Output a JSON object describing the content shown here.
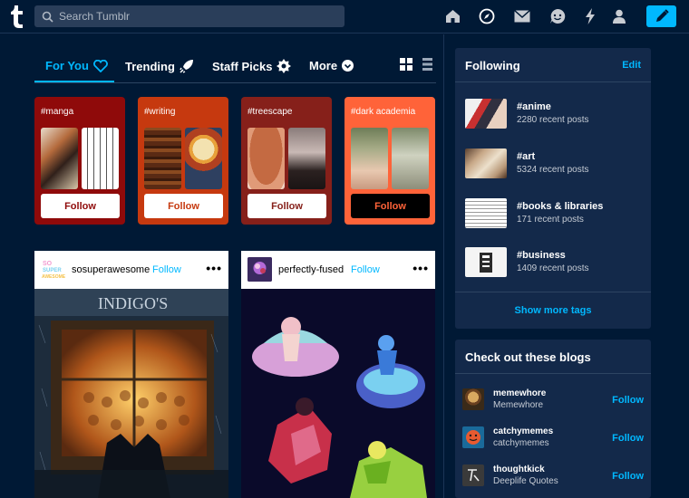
{
  "header": {
    "search_placeholder": "Search Tumblr",
    "accent": "#00b8ff"
  },
  "tabs": [
    {
      "label": "For You",
      "icon": "heart-icon",
      "active": true
    },
    {
      "label": "Trending",
      "icon": "rocket-icon"
    },
    {
      "label": "Staff Picks",
      "icon": "badge-icon"
    },
    {
      "label": "More",
      "icon": "chevron-down-icon"
    }
  ],
  "tag_cards": [
    {
      "tag": "#manga",
      "button": "Follow",
      "bg": "#8f0a0a"
    },
    {
      "tag": "#writing",
      "button": "Follow",
      "bg": "#c6390f"
    },
    {
      "tag": "#treescape",
      "button": "Follow",
      "bg": "#86201a"
    },
    {
      "tag": "#dark academia",
      "button": "Follow",
      "bg": "#ff6339"
    }
  ],
  "posts": [
    {
      "user": "sosuperawesome",
      "follow": "Follow",
      "more": "•••",
      "sign_text": "INDIGO'S"
    },
    {
      "user": "perfectly-fused",
      "follow": "Follow",
      "more": "•••"
    }
  ],
  "following": {
    "title": "Following",
    "edit": "Edit",
    "items": [
      {
        "tag": "#anime",
        "count": "2280 recent posts"
      },
      {
        "tag": "#art",
        "count": "5324 recent posts"
      },
      {
        "tag": "#books & libraries",
        "count": "171 recent posts"
      },
      {
        "tag": "#business",
        "count": "1409 recent posts"
      }
    ],
    "show_more": "Show more tags"
  },
  "blogs": {
    "title": "Check out these blogs",
    "items": [
      {
        "name": "memewhore",
        "desc": "Memewhore",
        "follow": "Follow"
      },
      {
        "name": "catchymemes",
        "desc": "catchymemes",
        "follow": "Follow"
      },
      {
        "name": "thoughtkick",
        "desc": "Deeplife Quotes",
        "follow": "Follow"
      }
    ]
  }
}
